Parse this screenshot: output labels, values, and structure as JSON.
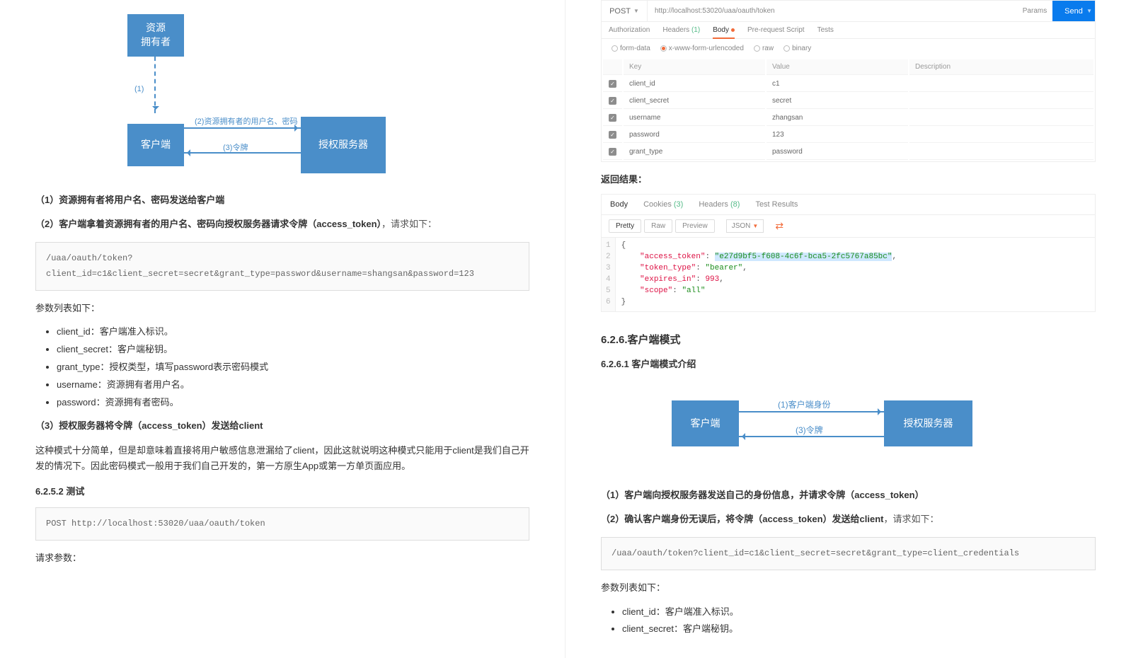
{
  "left": {
    "flow": {
      "owner": "资源\n拥有者",
      "client": "客户端",
      "server": "授权服务器",
      "arrow1": "(1)",
      "arrow2": "(2)资源拥有者的用户名、密码",
      "arrow3": "(3)令牌"
    },
    "p1": "（1）资源拥有者将用户名、密码发送给客户端",
    "p2_bold": "（2）客户端拿着资源拥有者的用户名、密码向授权服务器请求令牌（access_token）",
    "p2_tail": "，请求如下：",
    "code1": "/uaa/oauth/token?\nclient_id=c1&client_secret=secret&grant_type=password&username=shangsan&password=123",
    "param_intro": "参数列表如下：",
    "params": [
      "client_id：客户端准入标识。",
      "client_secret：客户端秘钥。",
      "grant_type：授权类型，填写password表示密码模式",
      "username：资源拥有者用户名。",
      "password：资源拥有者密码。"
    ],
    "p3": "（3）授权服务器将令牌（access_token）发送给client",
    "p4": "这种模式十分简单，但是却意味着直接将用户敏感信息泄漏给了client，因此这就说明这种模式只能用于client是我们自己开发的情况下。因此密码模式一般用于我们自己开发的，第一方原生App或第一方单页面应用。",
    "h_6252": "6.2.5.2 测试",
    "code2": "POST http://localhost:53020/uaa/oauth/token",
    "req_param_label": "请求参数："
  },
  "postman": {
    "method": "POST",
    "url": "http://localhost:53020/uaa/oauth/token",
    "params_btn": "Params",
    "send": "Send",
    "tabs": {
      "auth": "Authorization",
      "headers": "Headers",
      "headers_n": "(1)",
      "body": "Body",
      "prereq": "Pre-request Script",
      "tests": "Tests"
    },
    "radios": {
      "form": "form-data",
      "urlenc": "x-www-form-urlencoded",
      "raw": "raw",
      "binary": "binary"
    },
    "grid_hd": {
      "key": "Key",
      "value": "Value",
      "desc": "Description"
    },
    "grid": [
      {
        "k": "client_id",
        "v": "c1"
      },
      {
        "k": "client_secret",
        "v": "secret"
      },
      {
        "k": "username",
        "v": "zhangsan"
      },
      {
        "k": "password",
        "v": "123"
      },
      {
        "k": "grant_type",
        "v": "password"
      }
    ],
    "resp_label": "返回结果：",
    "rtabs": {
      "body": "Body",
      "cookies": "Cookies",
      "cookies_n": "(3)",
      "headers": "Headers",
      "headers_n": "(8)",
      "tests": "Test Results"
    },
    "tool": {
      "pretty": "Pretty",
      "raw": "Raw",
      "preview": "Preview",
      "json": "JSON"
    },
    "json": {
      "line_count": 6,
      "l1": "{",
      "l2_k": "\"access_token\"",
      "l2_v": "\"e27d9bf5-f608-4c6f-bca5-2fc5767a85bc\"",
      "l3_k": "\"token_type\"",
      "l3_v": "\"bearer\"",
      "l4_k": "\"expires_in\"",
      "l4_v": "993",
      "l5_k": "\"scope\"",
      "l5_v": "\"all\"",
      "l6": "}"
    }
  },
  "right": {
    "h_626": "6.2.6.客户端模式",
    "h_6261": "6.2.6.1 客户端模式介绍",
    "flow": {
      "client": "客户端",
      "server": "授权服务器",
      "a1": "(1)客户端身份",
      "a2": "(3)令牌"
    },
    "p1": "（1）客户端向授权服务器发送自己的身份信息，并请求令牌（access_token）",
    "p2_bold": "（2）确认客户端身份无误后，将令牌（access_token）发送给client",
    "p2_tail": "，请求如下：",
    "code": "/uaa/oauth/token?client_id=c1&client_secret=secret&grant_type=client_credentials",
    "param_intro": "参数列表如下：",
    "params": [
      "client_id：客户端准入标识。",
      "client_secret：客户端秘钥。"
    ]
  }
}
